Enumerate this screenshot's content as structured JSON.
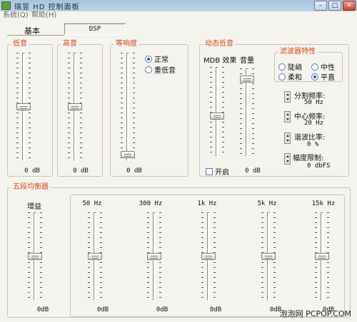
{
  "window": {
    "title": "瑞昱 HD 控制面板"
  },
  "menu": {
    "system": "系统(Q)",
    "help": "帮助(H)"
  },
  "tabs": {
    "basic": "基本",
    "dsp": "DSP"
  },
  "groups": {
    "bass": "低音",
    "treble": "高音",
    "loudness": "等响度",
    "dynamic_bass": "动态低音",
    "filter": "滤波器特性",
    "equalizer": "五段均衡器"
  },
  "sliders": {
    "bass_value": "0 dB",
    "treble_value": "0 dB",
    "loudness_value": "0 dB",
    "volume_value": "0 dB"
  },
  "loudness_mode": {
    "normal": "正常",
    "heavy_bass": "重低音"
  },
  "dynamic_bass": {
    "mdb_effect": "MDB 效果",
    "volume": "音量",
    "enable": "开启"
  },
  "filter_options": {
    "steep": "陡峭",
    "neutral": "中性",
    "soft": "柔和",
    "flat": "平直"
  },
  "spinners": [
    {
      "label": "分割频率:",
      "value": "50 Hz"
    },
    {
      "label": "中心频率:",
      "value": "20 Hz"
    },
    {
      "label": "谐波比率:",
      "value": "0 %"
    },
    {
      "label": "幅度限制:",
      "value": "0 dbFS"
    }
  ],
  "equalizer": {
    "gain_label": "增益",
    "gain_value": "0dB",
    "bands": [
      {
        "freq": "50 Hz",
        "value": "0dB"
      },
      {
        "freq": "300 Hz",
        "value": "0dB"
      },
      {
        "freq": "1k Hz",
        "value": "0dB"
      },
      {
        "freq": "5k Hz",
        "value": "0dB"
      },
      {
        "freq": "15k Hz",
        "value": "0dB"
      }
    ]
  },
  "watermark": "泡泡网 PCPOP.COM"
}
